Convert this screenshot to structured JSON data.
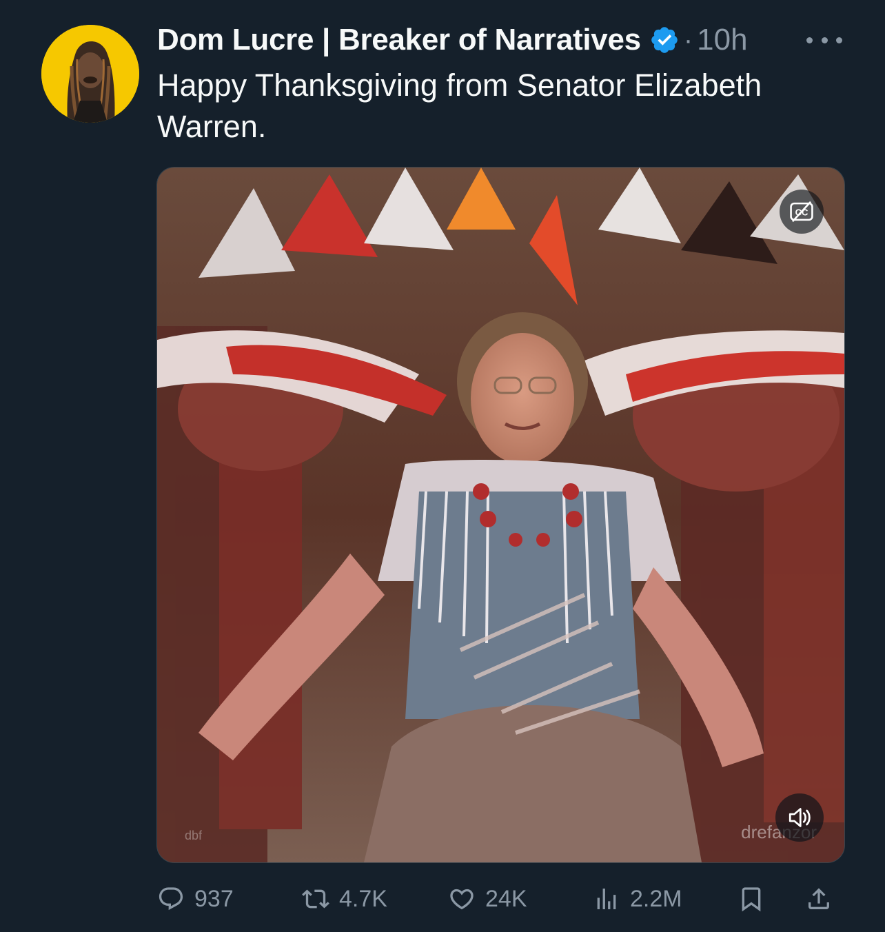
{
  "author": {
    "display_name": "Dom Lucre | Breaker of Narratives",
    "verified": true,
    "separator": "·",
    "time_ago": "10h"
  },
  "tweet": {
    "text": "Happy Thanksgiving from Senator Elizabeth Warren."
  },
  "media": {
    "type": "video",
    "watermark_left": "dbf",
    "watermark_right": "drefanzor",
    "controls": {
      "captions_icon": "cc-icon",
      "volume_icon": "speaker-icon"
    }
  },
  "actions": {
    "replies": "937",
    "reposts": "4.7K",
    "likes": "24K",
    "views": "2.2M"
  },
  "colors": {
    "background": "#15202b",
    "text_primary": "#f7f9f9",
    "text_secondary": "#8b98a5",
    "verified_blue": "#1d9bf0",
    "avatar_bg": "#f6c800"
  }
}
